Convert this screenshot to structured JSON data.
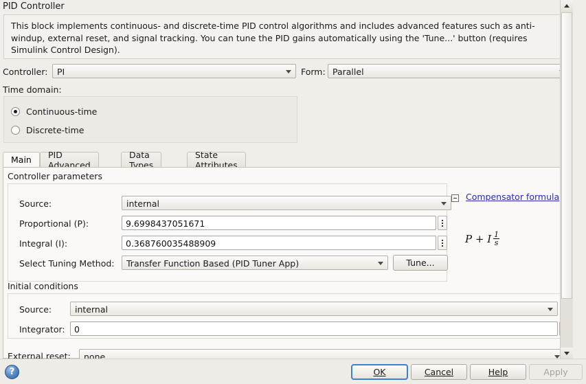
{
  "dialog": {
    "title": "PID Controller",
    "description": "This block implements continuous- and discrete-time PID control algorithms and includes advanced features such as anti-windup, external reset, and signal tracking. You can tune the PID gains automatically using the 'Tune...' button (requires Simulink Control Design)."
  },
  "top_row": {
    "controller_label": "Controller:",
    "controller_value": "PI",
    "form_label": "Form:",
    "form_value": "Parallel"
  },
  "time_domain": {
    "label": "Time domain:",
    "options": [
      {
        "label": "Continuous-time",
        "selected": true
      },
      {
        "label": "Discrete-time",
        "selected": false
      }
    ]
  },
  "tabs": [
    {
      "label": "Main",
      "active": true
    },
    {
      "label": "PID Advanced",
      "active": false
    },
    {
      "label": "Data Types",
      "active": false
    },
    {
      "label": "State Attributes",
      "active": false
    }
  ],
  "controller_parameters": {
    "section_label": "Controller parameters",
    "source_label": "Source:",
    "source_value": "internal",
    "proportional_label": "Proportional (P):",
    "proportional_value": "9.6998437051671",
    "integral_label": "Integral (I):",
    "integral_value": "0.368760035488909",
    "tuning_method_label": "Select Tuning Method:",
    "tuning_method_value": "Transfer Function Based (PID Tuner App)",
    "tune_button": "Tune..."
  },
  "compensator": {
    "link_label": "Compensator formula",
    "formula_prefix": "P + I",
    "formula_numerator": "1",
    "formula_denominator": "s",
    "collapse_icon": "collapse-minus-icon"
  },
  "initial_conditions": {
    "section_label": "Initial conditions",
    "source_label": "Source:",
    "source_value": "internal",
    "integrator_label": "Integrator:",
    "integrator_value": "0"
  },
  "external_reset": {
    "label": "External reset:",
    "value": "none"
  },
  "footer": {
    "help_icon": "help-question-icon",
    "ok": "OK",
    "cancel": "Cancel",
    "help": "Help",
    "apply": "Apply",
    "apply_disabled": true
  },
  "colors": {
    "dialog_bg": "#f0eee9",
    "panel_bg": "#fbf9f7",
    "link": "#2a2ab0",
    "focus_border": "#3f7fd0"
  }
}
